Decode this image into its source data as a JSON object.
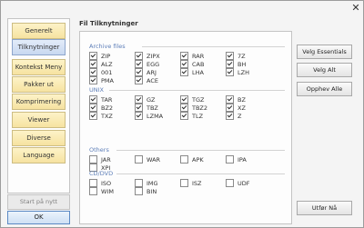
{
  "window": {
    "close_glyph": "✕"
  },
  "nav": {
    "items": [
      "Generelt",
      "Tilknytninger",
      "Kontekst Meny",
      "Pakker ut",
      "Komprimering",
      "Viewer",
      "Diverse",
      "Language"
    ],
    "selected_index": 1,
    "restart_label": "Start på nytt",
    "ok_label": "OK"
  },
  "main": {
    "title": "Fil Tilknytninger",
    "groups": [
      {
        "label": "Archive files",
        "items": [
          {
            "label": "ZIP",
            "checked": true
          },
          {
            "label": "ZIPX",
            "checked": true
          },
          {
            "label": "RAR",
            "checked": true
          },
          {
            "label": "7Z",
            "checked": true
          },
          {
            "label": "ALZ",
            "checked": true
          },
          {
            "label": "EGG",
            "checked": true
          },
          {
            "label": "CAB",
            "checked": true
          },
          {
            "label": "BH",
            "checked": true
          },
          {
            "label": "001",
            "checked": true
          },
          {
            "label": "ARJ",
            "checked": true
          },
          {
            "label": "LHA",
            "checked": true
          },
          {
            "label": "LZH",
            "checked": true
          },
          {
            "label": "PMA",
            "checked": true
          },
          {
            "label": "ACE",
            "checked": true
          }
        ]
      },
      {
        "label": "UNIX",
        "items": [
          {
            "label": "TAR",
            "checked": true
          },
          {
            "label": "GZ",
            "checked": true
          },
          {
            "label": "TGZ",
            "checked": true
          },
          {
            "label": "BZ",
            "checked": true
          },
          {
            "label": "BZ2",
            "checked": true
          },
          {
            "label": "TBZ",
            "checked": true
          },
          {
            "label": "TBZ2",
            "checked": true
          },
          {
            "label": "XZ",
            "checked": true
          },
          {
            "label": "TXZ",
            "checked": true
          },
          {
            "label": "LZMA",
            "checked": true
          },
          {
            "label": "TLZ",
            "checked": true
          },
          {
            "label": "Z",
            "checked": true
          }
        ]
      },
      {
        "label": "Others",
        "items": [
          {
            "label": "JAR",
            "checked": false
          },
          {
            "label": "WAR",
            "checked": false
          },
          {
            "label": "APK",
            "checked": false
          },
          {
            "label": "IPA",
            "checked": false
          },
          {
            "label": "XPI",
            "checked": false
          }
        ]
      },
      {
        "label": "CD/DVD",
        "items": [
          {
            "label": "ISO",
            "checked": false
          },
          {
            "label": "IMG",
            "checked": false
          },
          {
            "label": "ISZ",
            "checked": false
          },
          {
            "label": "UDF",
            "checked": false
          },
          {
            "label": "WIM",
            "checked": false
          },
          {
            "label": "BIN",
            "checked": false
          }
        ]
      }
    ]
  },
  "side": {
    "select_essentials": "Velg Essentials",
    "select_all": "Velg Alt",
    "deselect_all": "Opphev Alle",
    "execute": "Utfør Nå"
  }
}
